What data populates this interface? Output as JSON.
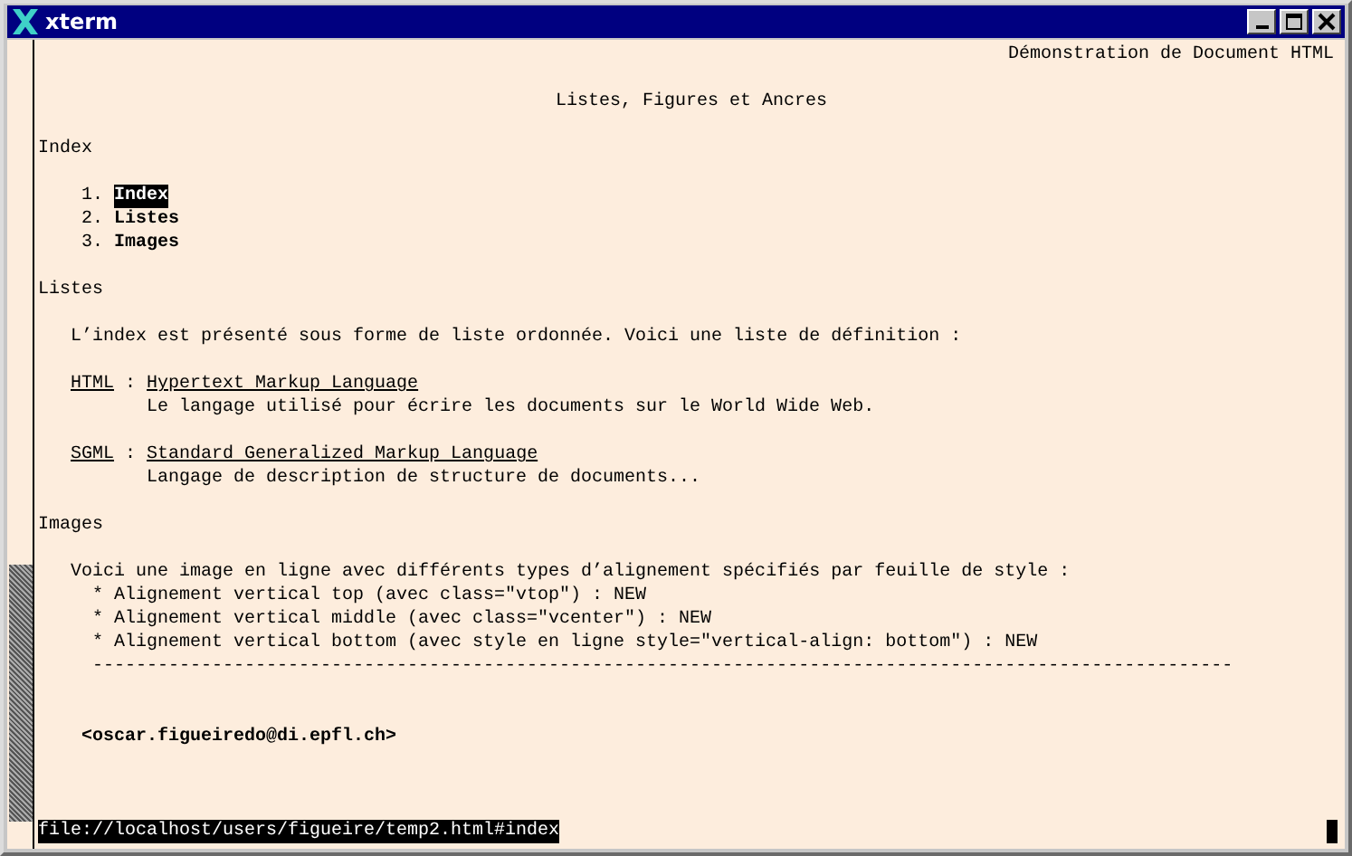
{
  "window": {
    "title": "xterm"
  },
  "document": {
    "header": "Démonstration de Document HTML",
    "title": "Listes, Figures et Ancres"
  },
  "index": {
    "heading": "Index",
    "items": [
      {
        "number": "1.",
        "label": "Index",
        "selected": true
      },
      {
        "number": "2.",
        "label": "Listes",
        "selected": false
      },
      {
        "number": "3.",
        "label": "Images",
        "selected": false
      }
    ]
  },
  "listes": {
    "heading": "Listes",
    "intro": "L’index est présenté sous forme de liste ordonnée. Voici une liste de définition :",
    "definitions": [
      {
        "term": "HTML",
        "separator": ":",
        "title": "Hypertext Markup Language",
        "description": "Le langage utilisé pour écrire les documents sur le World Wide Web."
      },
      {
        "term": "SGML",
        "separator": ":",
        "title": "Standard Generalized Markup Language",
        "description": "Langage de description de structure de documents..."
      }
    ]
  },
  "images": {
    "heading": "Images",
    "intro": "Voici une image en ligne avec différents types d’alignement spécifiés par feuille de style :",
    "bullets": [
      "* Alignement vertical top (avec class=\"vtop\") : NEW",
      "* Alignement vertical middle (avec class=\"vcenter\") : NEW",
      "* Alignement vertical bottom (avec style en ligne style=\"vertical-align: bottom\") : NEW"
    ],
    "rule": "---------------------------------------------------------------------------------------------------------"
  },
  "signature": "<oscar.figueiredo@di.epfl.ch>",
  "status_bar": {
    "url": "file://localhost/users/figueire/temp2.html#index"
  }
}
